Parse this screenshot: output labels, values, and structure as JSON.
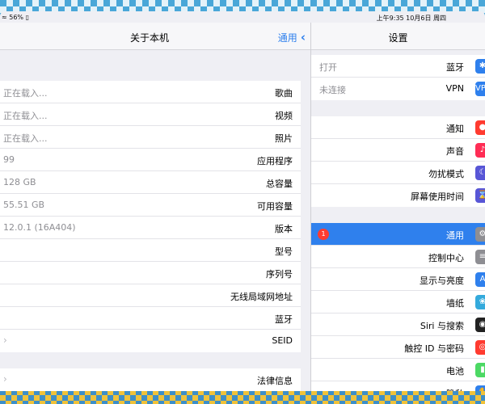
{
  "status_bar": {
    "left": "≈ 56% ▯",
    "right": "上午9:35  10月6日 周四"
  },
  "detail": {
    "title": "关于本机",
    "back_label": "通用",
    "rows": [
      {
        "label": "歌曲",
        "value": "正在载入..."
      },
      {
        "label": "视频",
        "value": "正在载入..."
      },
      {
        "label": "照片",
        "value": "正在载入..."
      },
      {
        "label": "应用程序",
        "value": "99"
      },
      {
        "label": "总容量",
        "value": "128 GB"
      },
      {
        "label": "可用容量",
        "value": "55.51 GB"
      },
      {
        "label": "版本",
        "value": "12.0.1 (16A404)"
      },
      {
        "label": "型号",
        "value": ""
      },
      {
        "label": "序列号",
        "value": ""
      },
      {
        "label": "无线局域网地址",
        "value": ""
      },
      {
        "label": "蓝牙",
        "value": ""
      },
      {
        "label": "SEID",
        "value": ""
      }
    ],
    "legal": {
      "label": "法律信息"
    }
  },
  "master": {
    "title": "设置",
    "group1": [
      {
        "label": "蓝牙",
        "value": "打开",
        "icon": "bluetooth-icon",
        "color": "#2f80ed",
        "glyph": "✱"
      },
      {
        "label": "VPN",
        "value": "未连接",
        "icon": "vpn-icon",
        "color": "#2f80ed",
        "glyph": "VPN"
      }
    ],
    "group2": [
      {
        "label": "通知",
        "icon": "notifications-icon",
        "color": "#ff3b30",
        "glyph": "●"
      },
      {
        "label": "声音",
        "icon": "sounds-icon",
        "color": "#ff2d55",
        "glyph": "♪"
      },
      {
        "label": "勿扰模式",
        "icon": "do-not-disturb-icon",
        "color": "#5856d6",
        "glyph": "☾"
      },
      {
        "label": "屏幕使用时间",
        "icon": "screen-time-icon",
        "color": "#5856d6",
        "glyph": "⌛"
      }
    ],
    "group3": [
      {
        "label": "通用",
        "icon": "gear-icon",
        "color": "#8e8e93",
        "glyph": "⚙",
        "badge": "1",
        "selected": true
      },
      {
        "label": "控制中心",
        "icon": "control-center-icon",
        "color": "#8e8e93",
        "glyph": "≡"
      },
      {
        "label": "显示与亮度",
        "icon": "display-icon",
        "color": "#2f80ed",
        "glyph": "A"
      },
      {
        "label": "墙纸",
        "icon": "wallpaper-icon",
        "color": "#34aadc",
        "glyph": "❀"
      },
      {
        "label": "Siri 与搜索",
        "icon": "siri-icon",
        "color": "#222222",
        "glyph": "◉"
      },
      {
        "label": "触控 ID 与密码",
        "icon": "touch-id-icon",
        "color": "#ff3b30",
        "glyph": "◎"
      },
      {
        "label": "电池",
        "icon": "battery-icon",
        "color": "#4cd964",
        "glyph": "▮"
      },
      {
        "label": "隐私",
        "icon": "privacy-icon",
        "color": "#2f80ed",
        "glyph": "✋"
      }
    ]
  }
}
